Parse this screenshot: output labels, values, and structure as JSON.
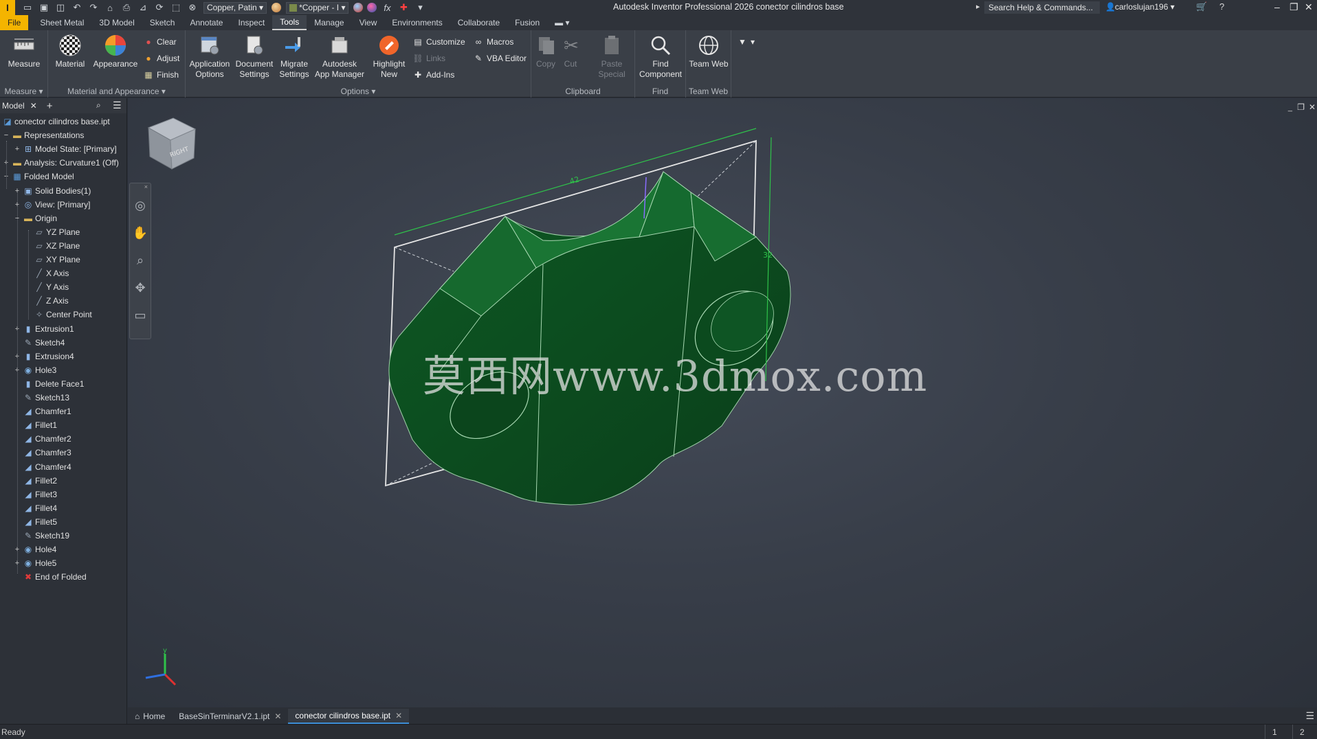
{
  "titlebar": {
    "logo": "I",
    "material_combo": "Copper, Patin",
    "appearance_combo": "*Copper - I",
    "fx_label": "fx",
    "app_title": "Autodesk Inventor Professional 2026   conector cilindros base",
    "search_placeholder": "Search Help & Commands...",
    "username": "carloslujan196"
  },
  "ribbon_tabs": [
    "File",
    "Sheet Metal",
    "3D Model",
    "Sketch",
    "Annotate",
    "Inspect",
    "Tools",
    "Manage",
    "View",
    "Environments",
    "Collaborate",
    "Fusion"
  ],
  "active_tab": "Tools",
  "ribbon": {
    "measure": {
      "label": "Measure",
      "panel": "Measure ▾"
    },
    "material_appearance": {
      "material": "Material",
      "appearance": "Appearance",
      "clear": "Clear",
      "adjust": "Adjust",
      "finish": "Finish",
      "panel": "Material and Appearance ▾"
    },
    "options": {
      "application_options_1": "Application",
      "application_options_2": "Options",
      "document_settings_1": "Document",
      "document_settings_2": "Settings",
      "migrate_settings_1": "Migrate",
      "migrate_settings_2": "Settings",
      "app_manager_1": "Autodesk",
      "app_manager_2": "App Manager",
      "highlight_new_1": "Highlight",
      "highlight_new_2": "New",
      "customize": "Customize",
      "links": "Links",
      "add_ins": "Add-Ins",
      "macros": "Macros",
      "vba_editor": "VBA Editor",
      "panel": "Options ▾"
    },
    "clipboard": {
      "copy": "Copy",
      "cut": "Cut",
      "paste_special_1": "Paste",
      "paste_special_2": "Special",
      "panel": "Clipboard"
    },
    "find": {
      "find_component_1": "Find",
      "find_component_2": "Component",
      "panel": "Find"
    },
    "team_web": {
      "label": "Team Web",
      "panel": "Team Web"
    }
  },
  "browser": {
    "tab_label": "Model",
    "tree": [
      {
        "label": "conector cilindros base.ipt",
        "depth": 0,
        "expander": ""
      },
      {
        "label": "Representations",
        "depth": 0,
        "expander": "−"
      },
      {
        "label": "Model State: [Primary]",
        "depth": 1,
        "expander": "+"
      },
      {
        "label": "Analysis: Curvature1 (Off)",
        "depth": 0,
        "expander": "+"
      },
      {
        "label": "Folded Model",
        "depth": 0,
        "expander": "−"
      },
      {
        "label": "Solid Bodies(1)",
        "depth": 1,
        "expander": "+"
      },
      {
        "label": "View: [Primary]",
        "depth": 1,
        "expander": "+"
      },
      {
        "label": "Origin",
        "depth": 1,
        "expander": "−"
      },
      {
        "label": "YZ Plane",
        "depth": 2,
        "expander": ""
      },
      {
        "label": "XZ Plane",
        "depth": 2,
        "expander": ""
      },
      {
        "label": "XY Plane",
        "depth": 2,
        "expander": ""
      },
      {
        "label": "X Axis",
        "depth": 2,
        "expander": ""
      },
      {
        "label": "Y Axis",
        "depth": 2,
        "expander": ""
      },
      {
        "label": "Z Axis",
        "depth": 2,
        "expander": ""
      },
      {
        "label": "Center Point",
        "depth": 2,
        "expander": ""
      },
      {
        "label": "Extrusion1",
        "depth": 1,
        "expander": "+"
      },
      {
        "label": "Sketch4",
        "depth": 1,
        "expander": ""
      },
      {
        "label": "Extrusion4",
        "depth": 1,
        "expander": "+"
      },
      {
        "label": "Hole3",
        "depth": 1,
        "expander": "+"
      },
      {
        "label": "Delete Face1",
        "depth": 1,
        "expander": ""
      },
      {
        "label": "Sketch13",
        "depth": 1,
        "expander": ""
      },
      {
        "label": "Chamfer1",
        "depth": 1,
        "expander": ""
      },
      {
        "label": "Fillet1",
        "depth": 1,
        "expander": ""
      },
      {
        "label": "Chamfer2",
        "depth": 1,
        "expander": ""
      },
      {
        "label": "Chamfer3",
        "depth": 1,
        "expander": ""
      },
      {
        "label": "Chamfer4",
        "depth": 1,
        "expander": ""
      },
      {
        "label": "Fillet2",
        "depth": 1,
        "expander": ""
      },
      {
        "label": "Fillet3",
        "depth": 1,
        "expander": ""
      },
      {
        "label": "Fillet4",
        "depth": 1,
        "expander": ""
      },
      {
        "label": "Fillet5",
        "depth": 1,
        "expander": ""
      },
      {
        "label": "Sketch19",
        "depth": 1,
        "expander": ""
      },
      {
        "label": "Hole4",
        "depth": 1,
        "expander": "+"
      },
      {
        "label": "Hole5",
        "depth": 1,
        "expander": "+"
      },
      {
        "label": "End of Folded",
        "depth": 1,
        "expander": ""
      }
    ]
  },
  "viewport": {
    "viewcube_label": "RIGHT",
    "dim_42": "42",
    "dim_32": "32",
    "watermark": "莫西网www.3dmox.com",
    "model_color": "#0f4f24"
  },
  "doc_tabs": {
    "home": "Home",
    "tab1": "BaseSinTerminarV2.1.ipt",
    "tab2": "conector cilindros base.ipt"
  },
  "status": {
    "text": "Ready",
    "cell1": "1",
    "cell2": "2"
  }
}
